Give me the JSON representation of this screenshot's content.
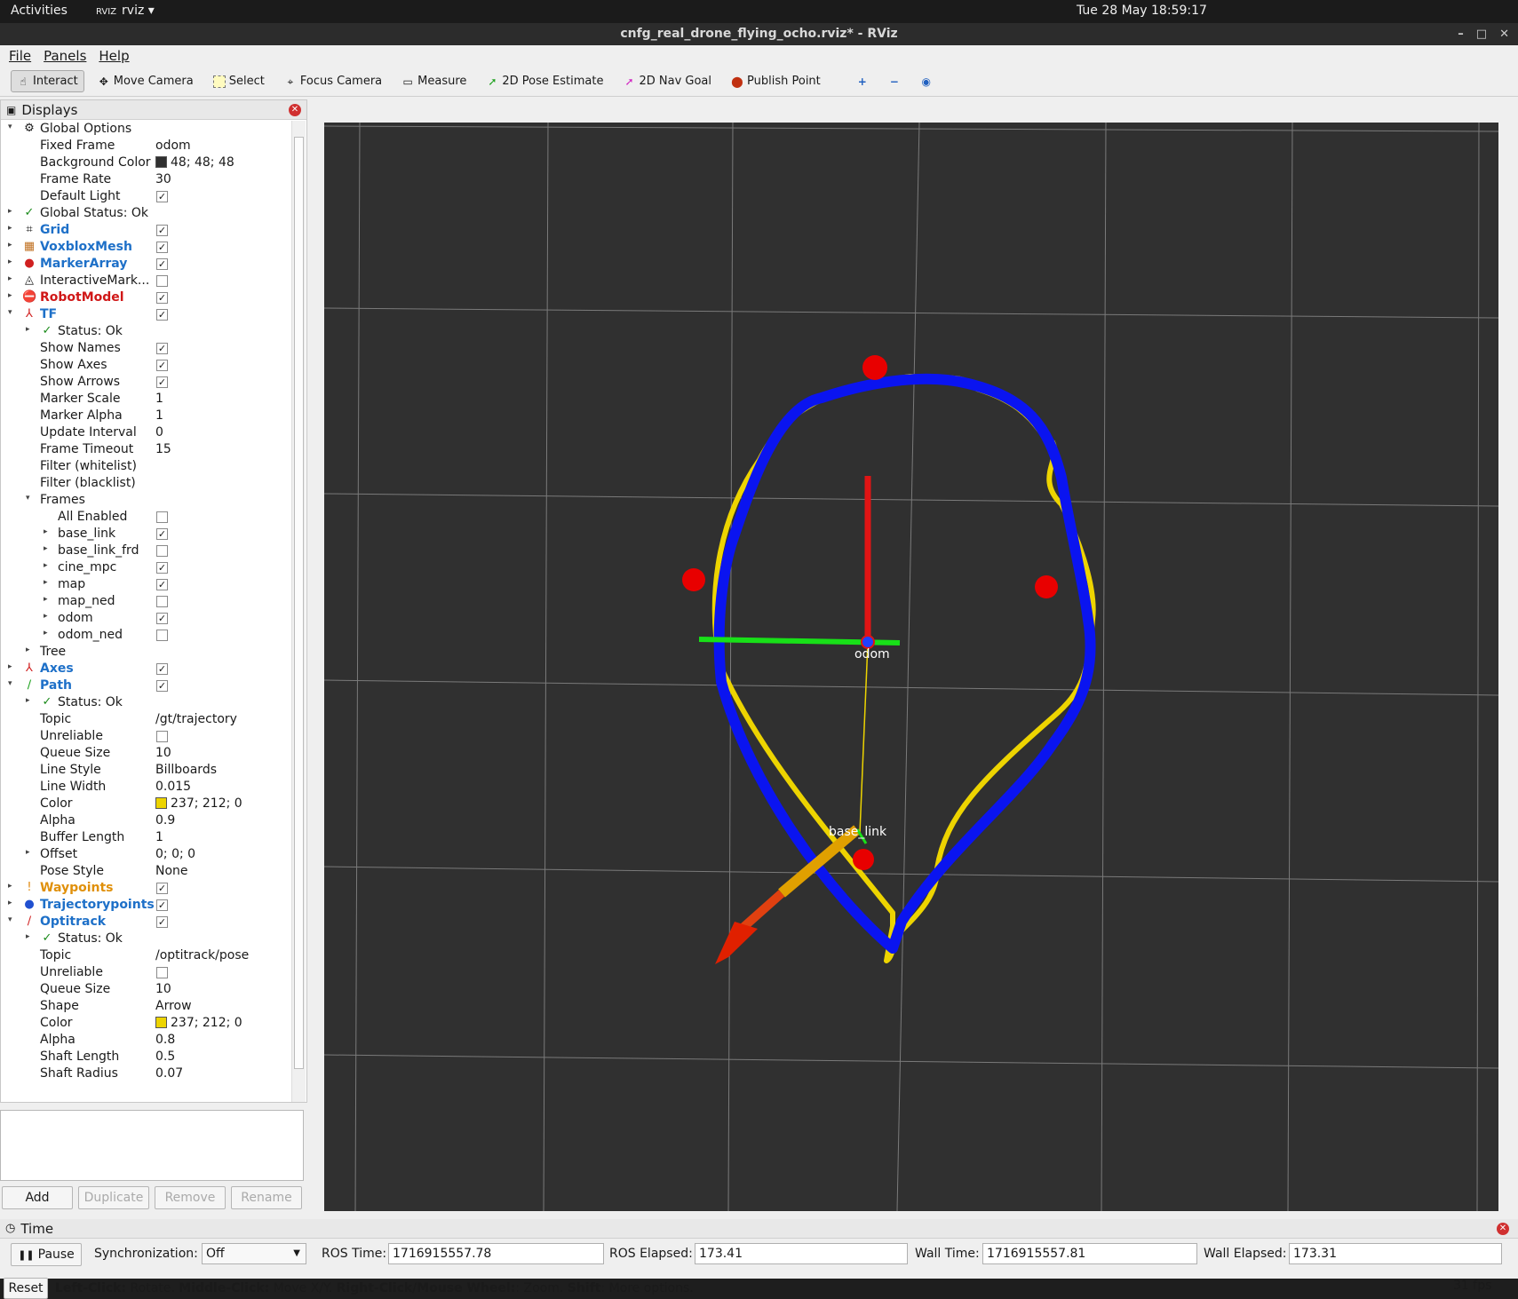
{
  "system": {
    "activities": "Activities",
    "app_menu": "rviz",
    "clock": "Tue 28 May  18:59:17"
  },
  "window": {
    "title": "cnfg_real_drone_flying_ocho.rviz* - RViz"
  },
  "menu": {
    "file": "File",
    "panels": "Panels",
    "help": "Help"
  },
  "toolbar": {
    "interact": "Interact",
    "move_camera": "Move Camera",
    "select": "Select",
    "focus_camera": "Focus Camera",
    "measure": "Measure",
    "pose_estimate": "2D Pose Estimate",
    "nav_goal": "2D Nav Goal",
    "publish_point": "Publish Point"
  },
  "displays": {
    "title": "Displays",
    "rows": [
      {
        "d": 0,
        "arrow": "▾",
        "icon": "⚙",
        "name": "Global Options",
        "style": ""
      },
      {
        "d": 1,
        "name": "Fixed Frame",
        "value": "odom"
      },
      {
        "d": 1,
        "name": "Background Color",
        "value": "48; 48; 48",
        "swatch": "#303030"
      },
      {
        "d": 1,
        "name": "Frame Rate",
        "value": "30"
      },
      {
        "d": 1,
        "name": "Default Light",
        "check": true
      },
      {
        "d": 0,
        "arrow": "▸",
        "icon": "✓",
        "iconColor": "#1a8a1a",
        "name": "Global Status: Ok",
        "style": ""
      },
      {
        "d": 0,
        "arrow": "▸",
        "icon": "⌗",
        "name": "Grid",
        "style": "blue",
        "check": true
      },
      {
        "d": 0,
        "arrow": "▸",
        "icon": "▦",
        "iconColor": "#c07020",
        "name": "VoxbloxMesh",
        "style": "blue",
        "check": true
      },
      {
        "d": 0,
        "arrow": "▸",
        "icon": "●",
        "iconColor": "#d02020",
        "name": "MarkerArray",
        "style": "blue",
        "check": true
      },
      {
        "d": 0,
        "arrow": "▸",
        "icon": "◬",
        "name": "InteractiveMark...",
        "style": "",
        "check": false
      },
      {
        "d": 0,
        "arrow": "▸",
        "icon": "⛔",
        "iconColor": "#d01818",
        "name": "RobotModel",
        "style": "red",
        "check": true
      },
      {
        "d": 0,
        "arrow": "▾",
        "icon": "⅄",
        "iconColor": "#d02020",
        "name": "TF",
        "style": "blue",
        "check": true
      },
      {
        "d": 1,
        "arrow": "▸",
        "icon": "✓",
        "iconColor": "#1a8a1a",
        "name": "Status: Ok"
      },
      {
        "d": 1,
        "name": "Show Names",
        "check": true
      },
      {
        "d": 1,
        "name": "Show Axes",
        "check": true
      },
      {
        "d": 1,
        "name": "Show Arrows",
        "check": true
      },
      {
        "d": 1,
        "name": "Marker Scale",
        "value": "1"
      },
      {
        "d": 1,
        "name": "Marker Alpha",
        "value": "1"
      },
      {
        "d": 1,
        "name": "Update Interval",
        "value": "0"
      },
      {
        "d": 1,
        "name": "Frame Timeout",
        "value": "15"
      },
      {
        "d": 1,
        "name": "Filter (whitelist)",
        "value": ""
      },
      {
        "d": 1,
        "name": "Filter (blacklist)",
        "value": ""
      },
      {
        "d": 1,
        "arrow": "▾",
        "name": "Frames"
      },
      {
        "d": 2,
        "name": "All Enabled",
        "check": false
      },
      {
        "d": 2,
        "arrow": "▸",
        "name": "base_link",
        "check": true
      },
      {
        "d": 2,
        "arrow": "▸",
        "name": "base_link_frd",
        "check": false
      },
      {
        "d": 2,
        "arrow": "▸",
        "name": "cine_mpc",
        "check": true
      },
      {
        "d": 2,
        "arrow": "▸",
        "name": "map",
        "check": true
      },
      {
        "d": 2,
        "arrow": "▸",
        "name": "map_ned",
        "check": false
      },
      {
        "d": 2,
        "arrow": "▸",
        "name": "odom",
        "check": true
      },
      {
        "d": 2,
        "arrow": "▸",
        "name": "odom_ned",
        "check": false
      },
      {
        "d": 1,
        "arrow": "▸",
        "name": "Tree"
      },
      {
        "d": 0,
        "arrow": "▸",
        "icon": "⅄",
        "iconColor": "#d02020",
        "name": "Axes",
        "style": "blue",
        "check": true
      },
      {
        "d": 0,
        "arrow": "▾",
        "icon": "∕",
        "iconColor": "#1aa01a",
        "name": "Path",
        "style": "blue",
        "check": true
      },
      {
        "d": 1,
        "arrow": "▸",
        "icon": "✓",
        "iconColor": "#1a8a1a",
        "name": "Status: Ok"
      },
      {
        "d": 1,
        "name": "Topic",
        "value": "/gt/trajectory"
      },
      {
        "d": 1,
        "name": "Unreliable",
        "check": false
      },
      {
        "d": 1,
        "name": "Queue Size",
        "value": "10"
      },
      {
        "d": 1,
        "name": "Line Style",
        "value": "Billboards"
      },
      {
        "d": 1,
        "name": "Line Width",
        "value": "0.015"
      },
      {
        "d": 1,
        "name": "Color",
        "value": "237; 212; 0",
        "swatch": "#edd400"
      },
      {
        "d": 1,
        "name": "Alpha",
        "value": "0.9"
      },
      {
        "d": 1,
        "name": "Buffer Length",
        "value": "1"
      },
      {
        "d": 1,
        "arrow": "▸",
        "name": "Offset",
        "value": "0; 0; 0"
      },
      {
        "d": 1,
        "name": "Pose Style",
        "value": "None"
      },
      {
        "d": 0,
        "arrow": "▸",
        "icon": "!",
        "iconColor": "#e08a10",
        "name": "Waypoints",
        "style": "orange",
        "check": true
      },
      {
        "d": 0,
        "arrow": "▸",
        "icon": "●",
        "iconColor": "#2050d0",
        "name": "Trajectorypoints",
        "style": "blue",
        "check": true
      },
      {
        "d": 0,
        "arrow": "▾",
        "icon": "∕",
        "iconColor": "#d02020",
        "name": "Optitrack",
        "style": "blue",
        "check": true
      },
      {
        "d": 1,
        "arrow": "▸",
        "icon": "✓",
        "iconColor": "#1a8a1a",
        "name": "Status: Ok"
      },
      {
        "d": 1,
        "name": "Topic",
        "value": "/optitrack/pose"
      },
      {
        "d": 1,
        "name": "Unreliable",
        "check": false
      },
      {
        "d": 1,
        "name": "Queue Size",
        "value": "10"
      },
      {
        "d": 1,
        "name": "Shape",
        "value": "Arrow"
      },
      {
        "d": 1,
        "name": "Color",
        "value": "237; 212; 0",
        "swatch": "#edd400"
      },
      {
        "d": 1,
        "name": "Alpha",
        "value": "0.8"
      },
      {
        "d": 1,
        "name": "Shaft Length",
        "value": "0.5"
      },
      {
        "d": 1,
        "name": "Shaft Radius",
        "value": "0.07"
      }
    ],
    "buttons": {
      "add": "Add",
      "duplicate": "Duplicate",
      "remove": "Remove",
      "rename": "Rename"
    }
  },
  "scene": {
    "frame_label_center": "odom",
    "frame_label_bottom": "base_link",
    "background": "#303030",
    "path_yellow": "#edd400",
    "path_blue": "#0a14f0"
  },
  "time": {
    "title": "Time",
    "pause": "Pause",
    "sync_label": "Synchronization:",
    "sync_value": "Off",
    "ros_time_label": "ROS Time:",
    "ros_time": "1716915557.78",
    "ros_elapsed_label": "ROS Elapsed:",
    "ros_elapsed": "173.41",
    "wall_time_label": "Wall Time:",
    "wall_time": "1716915557.81",
    "wall_elapsed_label": "Wall Elapsed:",
    "wall_elapsed": "173.31"
  },
  "status": {
    "reset": "Reset",
    "hint_b1": "Left-Click:",
    "hint_t1": " Rotate. ",
    "hint_b2": "Middle-Click:",
    "hint_t2": " Move X/Y. ",
    "hint_b3": "Right-Click/Mouse Wheel:",
    "hint_t3": ": Zoom. ",
    "hint_b4": "Shift",
    "hint_t4": ": More options.",
    "fps": "31 fps"
  }
}
